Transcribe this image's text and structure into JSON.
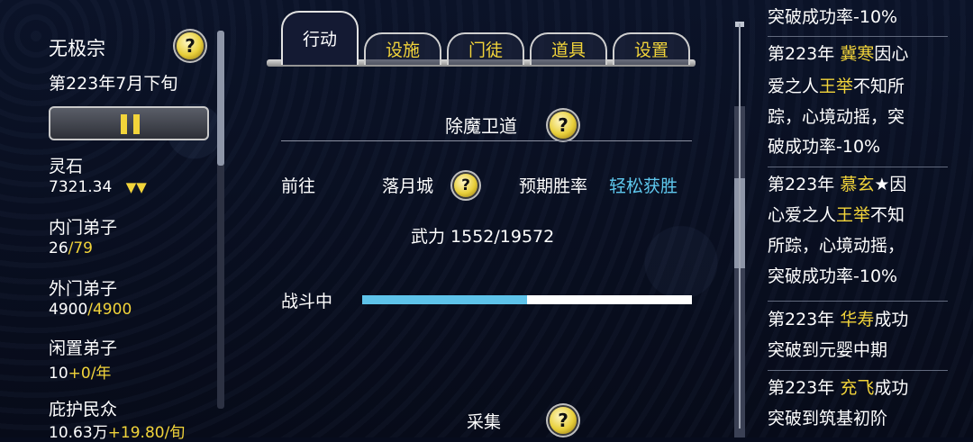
{
  "left": {
    "sect_name": "无极宗",
    "date": "第223年7月下旬",
    "resources": [
      {
        "label": "灵石",
        "value": "7321.34",
        "extra": "▼▼"
      },
      {
        "label": "内门弟子",
        "value": "26",
        "extra": "/79"
      },
      {
        "label": "外门弟子",
        "value": "4900",
        "extra": "/4900"
      },
      {
        "label": "闲置弟子",
        "value": "10",
        "extra": "+0/年"
      },
      {
        "label": "庇护民众",
        "value": "10.63万",
        "extra": "+19.80/旬"
      }
    ]
  },
  "tabs": [
    {
      "label": "行动",
      "active": true
    },
    {
      "label": "设施",
      "active": false
    },
    {
      "label": "门徒",
      "active": false
    },
    {
      "label": "道具",
      "active": false
    },
    {
      "label": "设置",
      "active": false
    }
  ],
  "mission": {
    "title": "除魔卫道",
    "goto_label": "前往",
    "destination": "落月城",
    "win_rate_label": "预期胜率",
    "win_rate_value": "轻松获胜",
    "force": "武力 1552/19572",
    "status_label": "战斗中",
    "progress": 0.5
  },
  "next_section": {
    "title": "采集"
  },
  "help_symbol": "?",
  "log": [
    {
      "lines": [
        [
          [
            "突破成功率-10%",
            "w"
          ]
        ]
      ]
    },
    {
      "lines": [
        [
          [
            "第223年 ",
            "w"
          ],
          [
            "冀寒",
            "y"
          ],
          [
            "因心",
            "w"
          ]
        ],
        [
          [
            "爱之人",
            "w"
          ],
          [
            "王举",
            "y"
          ],
          [
            "不知所",
            "w"
          ]
        ],
        [
          [
            "踪，心境动摇，突",
            "w"
          ]
        ],
        [
          [
            "破成功率-10%",
            "w"
          ]
        ]
      ]
    },
    {
      "lines": [
        [
          [
            "第223年 ",
            "w"
          ],
          [
            "慕玄",
            "y"
          ],
          [
            "★因",
            "w"
          ]
        ],
        [
          [
            "心爱之人",
            "w"
          ],
          [
            "王举",
            "y"
          ],
          [
            "不知",
            "w"
          ]
        ],
        [
          [
            "所踪，心境动摇，",
            "w"
          ]
        ],
        [
          [
            "突破成功率-10%",
            "w"
          ]
        ]
      ]
    },
    {
      "lines": [
        [
          [
            "第223年 ",
            "w"
          ],
          [
            "华寿",
            "y"
          ],
          [
            "成功",
            "w"
          ]
        ],
        [
          [
            "突破到元婴中期",
            "w"
          ]
        ]
      ]
    },
    {
      "lines": [
        [
          [
            "第223年 ",
            "w"
          ],
          [
            "充飞",
            "y"
          ],
          [
            "成功",
            "w"
          ]
        ],
        [
          [
            "突破到筑基初阶",
            "w"
          ]
        ]
      ]
    }
  ]
}
